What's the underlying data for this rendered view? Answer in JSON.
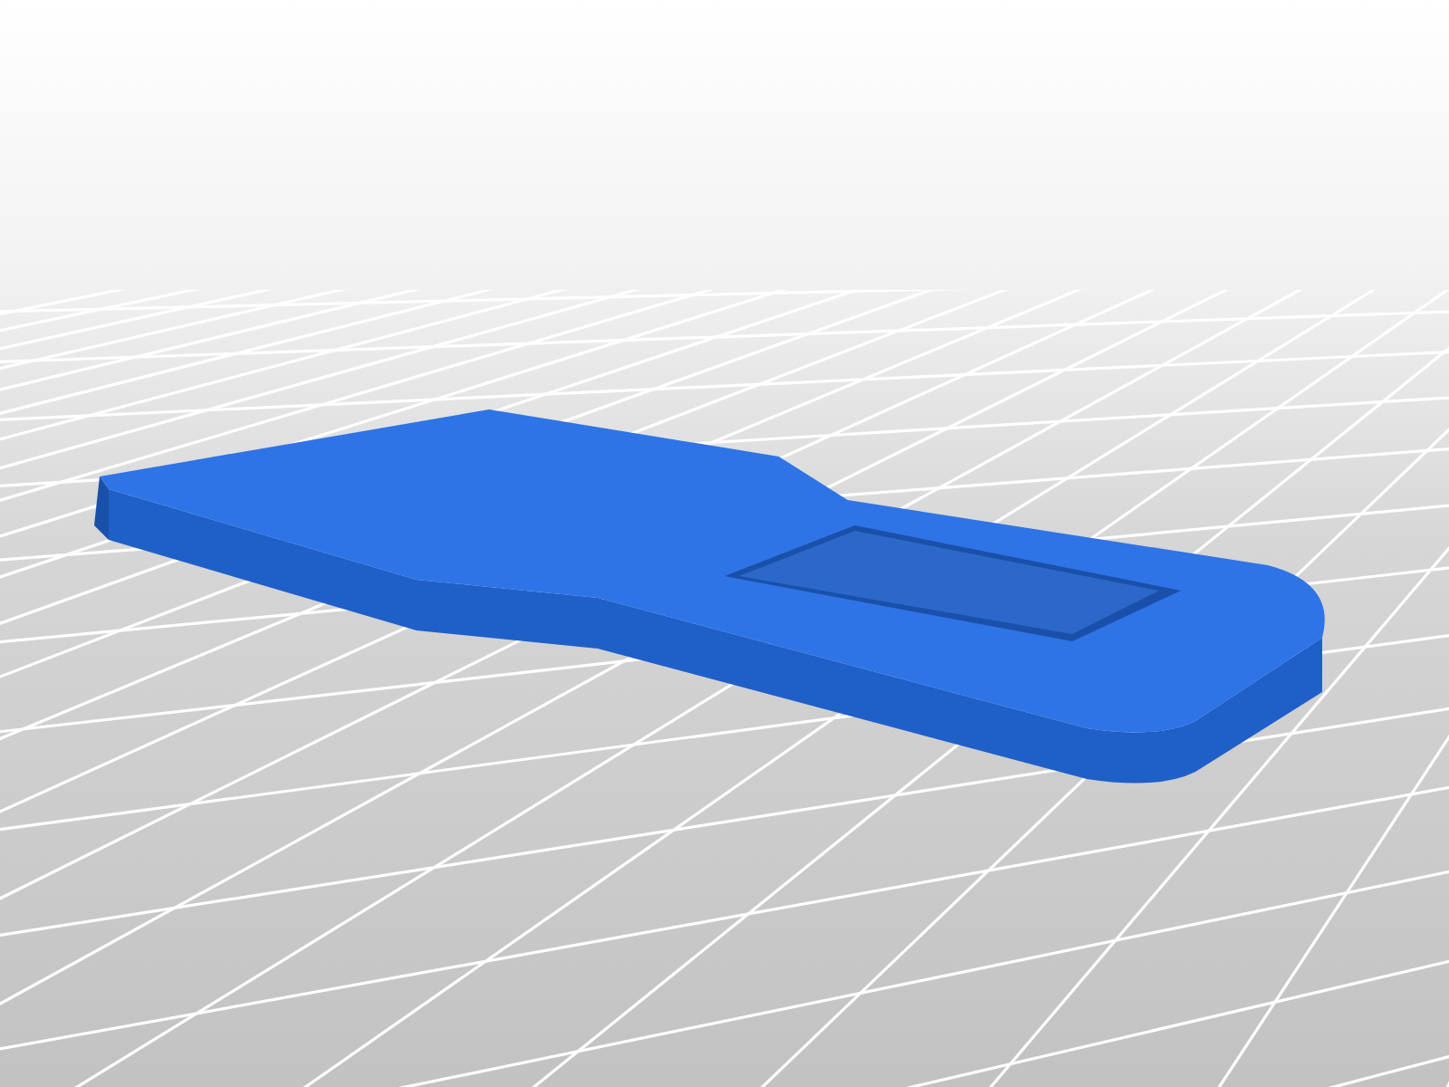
{
  "viewport": {
    "kind": "grid-render"
  }
}
